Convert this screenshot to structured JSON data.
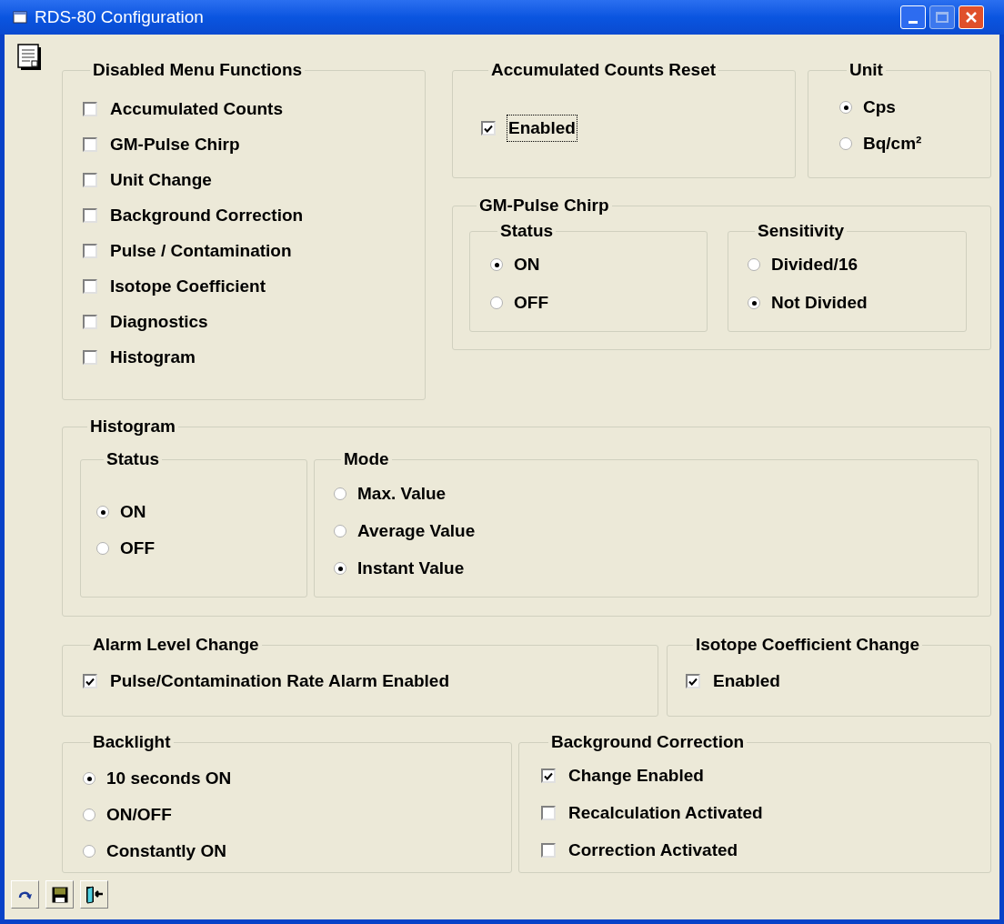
{
  "window": {
    "title": "RDS-80 Configuration"
  },
  "disabled_menu_functions": {
    "title": "Disabled Menu Functions",
    "items": [
      {
        "label": "Accumulated Counts",
        "checked": false,
        "focused": false
      },
      {
        "label": "GM-Pulse Chirp",
        "checked": false,
        "focused": false
      },
      {
        "label": "Unit Change",
        "checked": false,
        "focused": false
      },
      {
        "label": "Background Correction",
        "checked": false,
        "focused": false
      },
      {
        "label": "Pulse / Contamination",
        "checked": false,
        "focused": false
      },
      {
        "label": "Isotope Coefficient",
        "checked": false,
        "focused": false
      },
      {
        "label": "Diagnostics",
        "checked": false,
        "focused": false
      },
      {
        "label": "Histogram",
        "checked": false,
        "focused": false
      }
    ]
  },
  "accumulated_counts_reset": {
    "title": "Accumulated Counts Reset",
    "items": [
      {
        "label": "Enabled",
        "checked": true,
        "focused": true
      }
    ]
  },
  "unit": {
    "title": "Unit",
    "options": [
      {
        "label": "Cps",
        "selected": true
      },
      {
        "label": "Bq/cm²",
        "selected": false
      }
    ]
  },
  "gm_pulse_chirp": {
    "title": "GM-Pulse Chirp",
    "status": {
      "title": "Status",
      "options": [
        {
          "label": "ON",
          "selected": true
        },
        {
          "label": "OFF",
          "selected": false
        }
      ]
    },
    "sensitivity": {
      "title": "Sensitivity",
      "options": [
        {
          "label": "Divided/16",
          "selected": false
        },
        {
          "label": "Not Divided",
          "selected": true
        }
      ]
    }
  },
  "histogram": {
    "title": "Histogram",
    "status": {
      "title": "Status",
      "options": [
        {
          "label": "ON",
          "selected": true
        },
        {
          "label": "OFF",
          "selected": false
        }
      ]
    },
    "mode": {
      "title": "Mode",
      "options": [
        {
          "label": "Max. Value",
          "selected": false
        },
        {
          "label": "Average Value",
          "selected": false
        },
        {
          "label": "Instant Value",
          "selected": true
        }
      ]
    }
  },
  "alarm_level_change": {
    "title": "Alarm Level Change",
    "items": [
      {
        "label": "Pulse/Contamination Rate Alarm Enabled",
        "checked": true,
        "focused": false
      }
    ]
  },
  "isotope_coefficient_change": {
    "title": "Isotope Coefficient Change",
    "items": [
      {
        "label": "Enabled",
        "checked": true,
        "focused": false
      }
    ]
  },
  "backlight": {
    "title": "Backlight",
    "options": [
      {
        "label": "10 seconds ON",
        "selected": true
      },
      {
        "label": "ON/OFF",
        "selected": false
      },
      {
        "label": "Constantly ON",
        "selected": false
      }
    ]
  },
  "background_correction": {
    "title": "Background Correction",
    "items": [
      {
        "label": "Change Enabled",
        "checked": true,
        "focused": false
      },
      {
        "label": "Recalculation Activated",
        "checked": false,
        "focused": false
      },
      {
        "label": "Correction Activated",
        "checked": false,
        "focused": false
      }
    ]
  }
}
